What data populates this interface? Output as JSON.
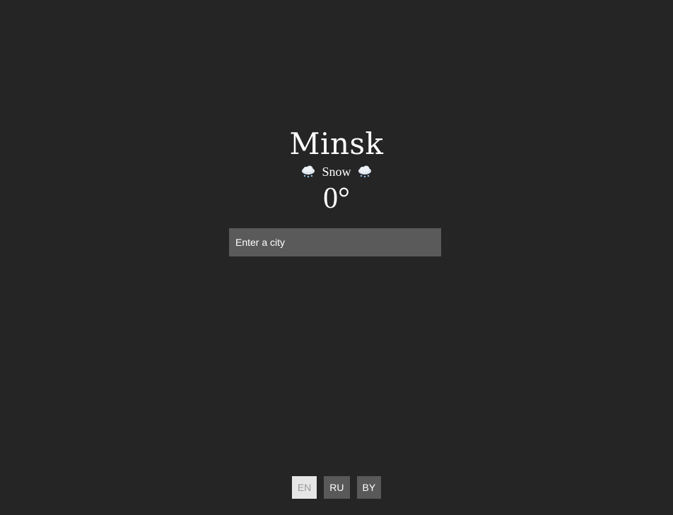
{
  "weather": {
    "city": "Minsk",
    "condition": "Snow",
    "condition_icon": "cloud-snow-icon",
    "temperature": "0°"
  },
  "search": {
    "placeholder": "Enter a city"
  },
  "languages": {
    "items": [
      {
        "label": "EN",
        "active": true
      },
      {
        "label": "RU",
        "active": false
      },
      {
        "label": "BY",
        "active": false
      }
    ]
  },
  "colors": {
    "background": "#252525",
    "input_background": "#5a5a5a",
    "button_active": "#e6e6e6",
    "button_inactive": "#595959",
    "text": "#ffffff"
  }
}
